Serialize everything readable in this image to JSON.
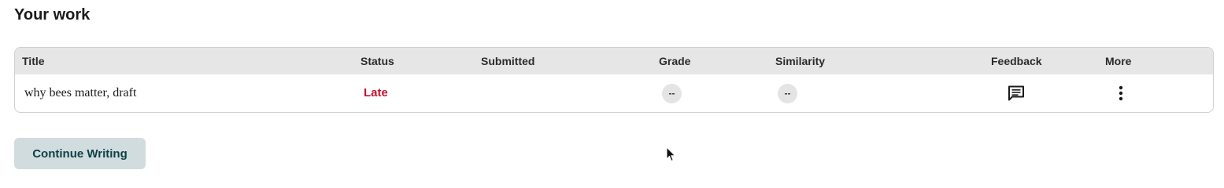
{
  "section": {
    "title": "Your work"
  },
  "table": {
    "headers": {
      "title": "Title",
      "status": "Status",
      "submitted": "Submitted",
      "grade": "Grade",
      "similarity": "Similarity",
      "feedback": "Feedback",
      "more": "More"
    },
    "rows": [
      {
        "title": "why bees matter, draft",
        "status": "Late",
        "submitted": "",
        "grade": "--",
        "similarity": "--",
        "feedback_icon": "comment-icon",
        "more_icon": "kebab-menu-icon"
      }
    ]
  },
  "actions": {
    "continue_label": "Continue Writing"
  },
  "colors": {
    "late_status": "#c8102e",
    "continue_button_bg": "#d0dcdd",
    "continue_button_text": "#0f3f46",
    "header_bg": "#e6e6e6"
  }
}
